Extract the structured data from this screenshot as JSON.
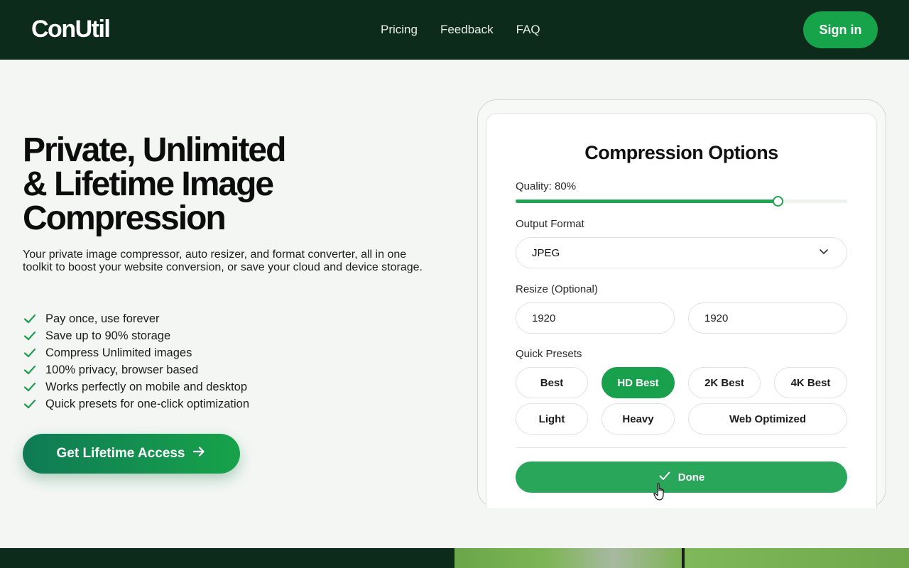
{
  "header": {
    "logo": "ConUtil",
    "nav": [
      "Pricing",
      "Feedback",
      "FAQ"
    ],
    "signin_label": "Sign in"
  },
  "hero": {
    "title_lines": [
      "Private, Unlimited",
      "& Lifetime Image",
      "Compression"
    ],
    "subtitle": "Your private image compressor, auto resizer, and format converter, all in one toolkit to boost your website conversion, or save your cloud and device storage.",
    "features": [
      "Pay once, use forever",
      "Save up to 90% storage",
      "Compress Unlimited images",
      "100% privacy, browser based",
      "Works perfectly on mobile and desktop",
      "Quick presets for one-click optimization"
    ],
    "cta_label": "Get Lifetime Access"
  },
  "options": {
    "title": "Compression Options",
    "quality_label": "Quality: 80%",
    "quality_fraction": 0.79,
    "format_label": "Output Format",
    "format_value": "JPEG",
    "resize_label": "Resize (Optional)",
    "resize_width": "1920",
    "resize_height": "1920",
    "presets_label": "Quick Presets",
    "presets": [
      "Best",
      "HD Best",
      "2K Best",
      "4K Best",
      "Light",
      "Heavy",
      "Web Optimized"
    ],
    "active_preset": "HD Best",
    "done_label": "Done"
  },
  "colors": {
    "header_bg": "#0d2b1a",
    "accent": "#17a34a"
  }
}
